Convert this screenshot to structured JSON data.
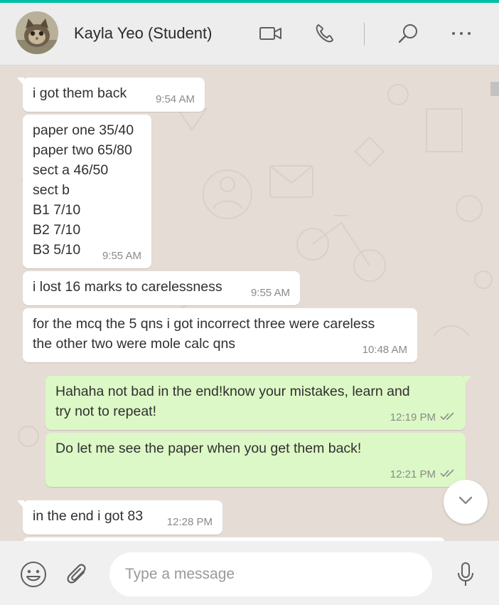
{
  "header": {
    "contact_name": "Kayla Yeo (Student)",
    "icons": [
      "video-camera-icon",
      "phone-icon",
      "search-icon",
      "more-options-icon"
    ]
  },
  "messages": [
    {
      "direction": "in",
      "text": "i got them back",
      "time": "9:54 AM"
    },
    {
      "direction": "in",
      "text": "paper one 35/40\npaper two 65/80\nsect a 46/50\nsect b\nB1 7/10\nB2 7/10\nB3 5/10",
      "time": "9:55 AM"
    },
    {
      "direction": "in",
      "text": "i lost 16 marks to carelessness",
      "time": "9:55 AM"
    },
    {
      "direction": "in",
      "text": "for the mcq the 5 qns i got incorrect three were careless\nthe other two were mole calc qns",
      "time": "10:48 AM"
    },
    {
      "direction": "out",
      "text": "Hahaha not bad in the end!know your mistakes, learn and\ntry not to repeat!",
      "time": "12:19 PM",
      "read": true
    },
    {
      "direction": "out",
      "text": "Do let me see the paper when you get them back!",
      "time": "12:21 PM",
      "read": true
    },
    {
      "direction": "in",
      "text": "in the end i got 83",
      "time": "12:28 PM"
    }
  ],
  "composer": {
    "placeholder": "Type a message"
  },
  "colors": {
    "accent": "#00bfa5",
    "chat_background": "#e5ddd5",
    "incoming_bubble": "#ffffff",
    "outgoing_bubble": "#dcf8c6",
    "read_ticks": "#8a8a8a"
  }
}
